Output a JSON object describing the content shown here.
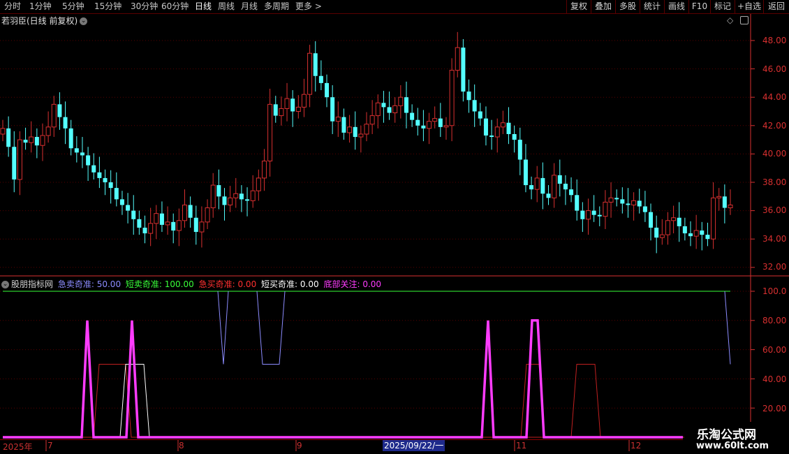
{
  "toolbar": {
    "periods": [
      "分时",
      "1分钟",
      "5分钟",
      "15分钟",
      "30分钟",
      "60分钟",
      "日线",
      "周线",
      "月线",
      "多周期",
      "更多"
    ],
    "active_period": "日线",
    "right_buttons": [
      "复权",
      "叠加",
      "多股",
      "统计",
      "画线",
      "F10",
      "标记",
      "+自选",
      "返回"
    ]
  },
  "chart": {
    "title": "若羽臣(日线 前复权)",
    "price_axis": [
      "48.00",
      "46.00",
      "44.00",
      "42.00",
      "40.00",
      "38.00",
      "36.00",
      "34.00",
      "32.00"
    ],
    "indicator_axis": [
      "100.0",
      "80.00",
      "60.00",
      "40.00",
      "20.00"
    ],
    "colors": {
      "up": "#d83030",
      "down": "#54ffff",
      "grid": "#5a0000",
      "axis": "#d83030"
    }
  },
  "indicator": {
    "name": "股朋指标网",
    "items": [
      {
        "label": "急卖奇准:",
        "value": "50.00",
        "color": "#8c8cff"
      },
      {
        "label": "短卖奇准:",
        "value": "100.00",
        "color": "#39ff39"
      },
      {
        "label": "急买奇准:",
        "value": "0.00",
        "color": "#ff3030"
      },
      {
        "label": "短买奇准:",
        "value": "0.00",
        "color": "#ffffff"
      },
      {
        "label": "底部关注:",
        "value": "0.00",
        "color": "#ff3cff"
      }
    ]
  },
  "timeline": {
    "year": "2025年",
    "months": [
      "7",
      "8",
      "9",
      "11",
      "12"
    ],
    "cursor_date": "2025/09/22/一"
  },
  "watermark": {
    "line1": "乐淘公式网",
    "line2": "www.60lt.com"
  }
}
